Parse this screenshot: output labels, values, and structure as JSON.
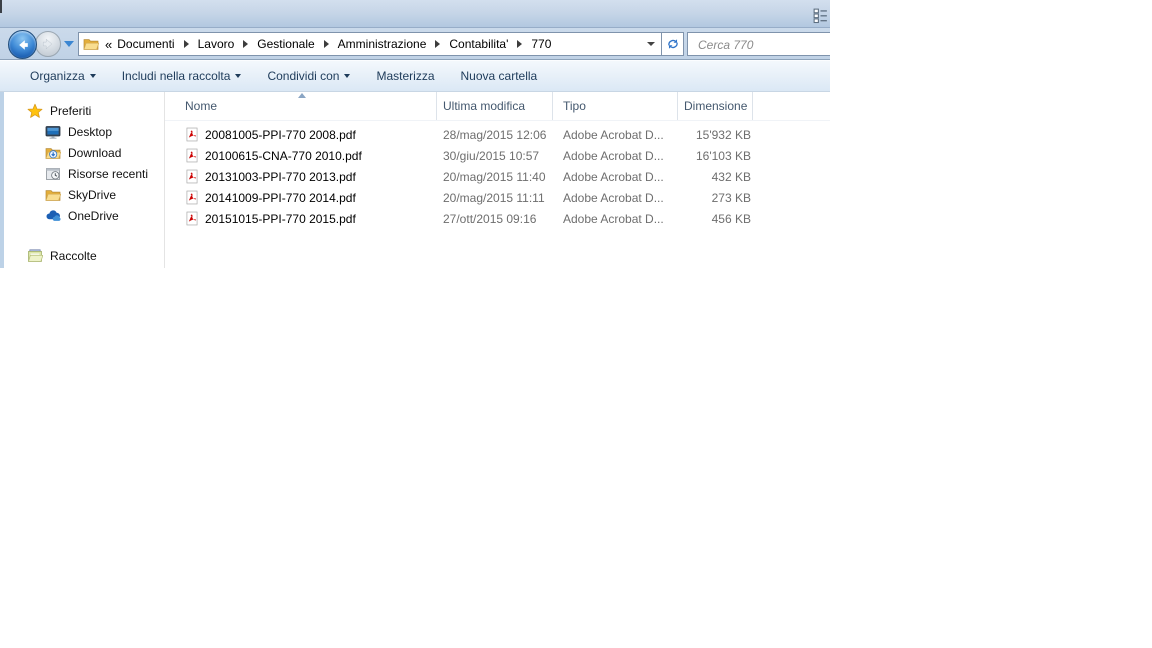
{
  "window": {
    "breadcrumb": {
      "prefix": "«",
      "items": [
        {
          "label": "Documenti"
        },
        {
          "label": "Lavoro"
        },
        {
          "label": "Gestionale"
        },
        {
          "label": "Amministrazione"
        },
        {
          "label": "Contabilita'"
        },
        {
          "label": "770"
        }
      ]
    },
    "search": {
      "placeholder": "Cerca 770"
    },
    "toolbar": {
      "items": [
        {
          "label": "Organizza",
          "dropdown": true
        },
        {
          "label": "Includi nella raccolta",
          "dropdown": true
        },
        {
          "label": "Condividi con",
          "dropdown": true
        },
        {
          "label": "Masterizza",
          "dropdown": false
        },
        {
          "label": "Nuova cartella",
          "dropdown": false
        }
      ]
    },
    "sidebar": {
      "items": [
        {
          "label": "Preferiti",
          "icon": "star",
          "level": 0
        },
        {
          "label": "Desktop",
          "icon": "desktop",
          "level": 1
        },
        {
          "label": "Download",
          "icon": "download",
          "level": 1
        },
        {
          "label": "Risorse recenti",
          "icon": "recent",
          "level": 1
        },
        {
          "label": "SkyDrive",
          "icon": "folder",
          "level": 1
        },
        {
          "label": "OneDrive",
          "icon": "cloud",
          "level": 1
        },
        {
          "label": "Raccolte",
          "icon": "libraries",
          "level": 0,
          "gap": true
        }
      ]
    },
    "file_list": {
      "columns": {
        "name": "Nome",
        "modified": "Ultima modifica",
        "type": "Tipo",
        "size": "Dimensione"
      },
      "sort": {
        "column": "Nome",
        "direction": "ascending"
      },
      "rows": [
        {
          "icon": "pdf",
          "name": "20081005-PPI-770 2008.pdf",
          "modified": "28/mag/2015 12:06",
          "type": "Adobe Acrobat D...",
          "size": "15'932 KB"
        },
        {
          "icon": "pdf",
          "name": "20100615-CNA-770 2010.pdf",
          "modified": "30/giu/2015 10:57",
          "type": "Adobe Acrobat D...",
          "size": "16'103 KB"
        },
        {
          "icon": "pdf",
          "name": "20131003-PPI-770 2013.pdf",
          "modified": "20/mag/2015 11:40",
          "type": "Adobe Acrobat D...",
          "size": "432 KB"
        },
        {
          "icon": "pdf",
          "name": "20141009-PPI-770 2014.pdf",
          "modified": "20/mag/2015 11:11",
          "type": "Adobe Acrobat D...",
          "size": "273 KB"
        },
        {
          "icon": "pdf",
          "name": "20151015-PPI-770 2015.pdf",
          "modified": "27/ott/2015 09:16",
          "type": "Adobe Acrobat D...",
          "size": "456 KB"
        }
      ]
    },
    "colors": {
      "glass_blue": "#bfd1e6",
      "folder_yellow": "#f2c14e",
      "pdf_red": "#cc0000",
      "onedrive_blue": "#1b5fb4",
      "header_text": "#44586e"
    }
  }
}
